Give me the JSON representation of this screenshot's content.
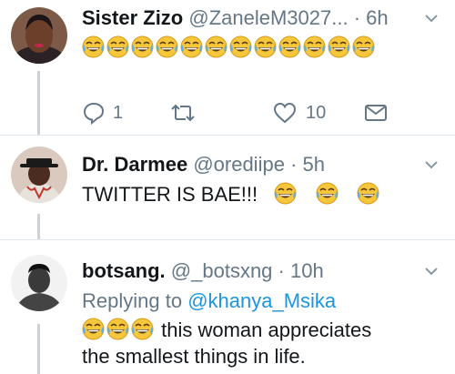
{
  "tweets": [
    {
      "name": "Sister Zizo",
      "handle": "@ZaneleM3027...",
      "dot": "·",
      "time": "6h",
      "emoji_count": 12,
      "actions": {
        "reply_count": "1",
        "like_count": "10"
      }
    },
    {
      "name": "Dr. Darmee",
      "handle": "@orediipe",
      "dot": "·",
      "time": "5h",
      "text": "TWITTER IS BAE!!!"
    },
    {
      "name": "botsang.",
      "handle": "@_botsxng",
      "dot": "·",
      "time": "10h",
      "replying_prefix": "Replying to",
      "replying_handle": "@khanya_Msika",
      "text_line1": "this woman appreciates",
      "text_line2": "the smallest things in life."
    }
  ],
  "icons": {
    "emoji": "face-with-tears-of-joy-icon",
    "chevron": "chevron-down-icon",
    "reply": "reply-icon",
    "retweet": "retweet-icon",
    "like": "heart-icon",
    "dm": "envelope-icon"
  },
  "colors": {
    "name": "#14171a",
    "meta": "#657786",
    "link": "#1b95e0",
    "divider": "#e1e8ed",
    "thread_line": "#c8d3dc"
  }
}
